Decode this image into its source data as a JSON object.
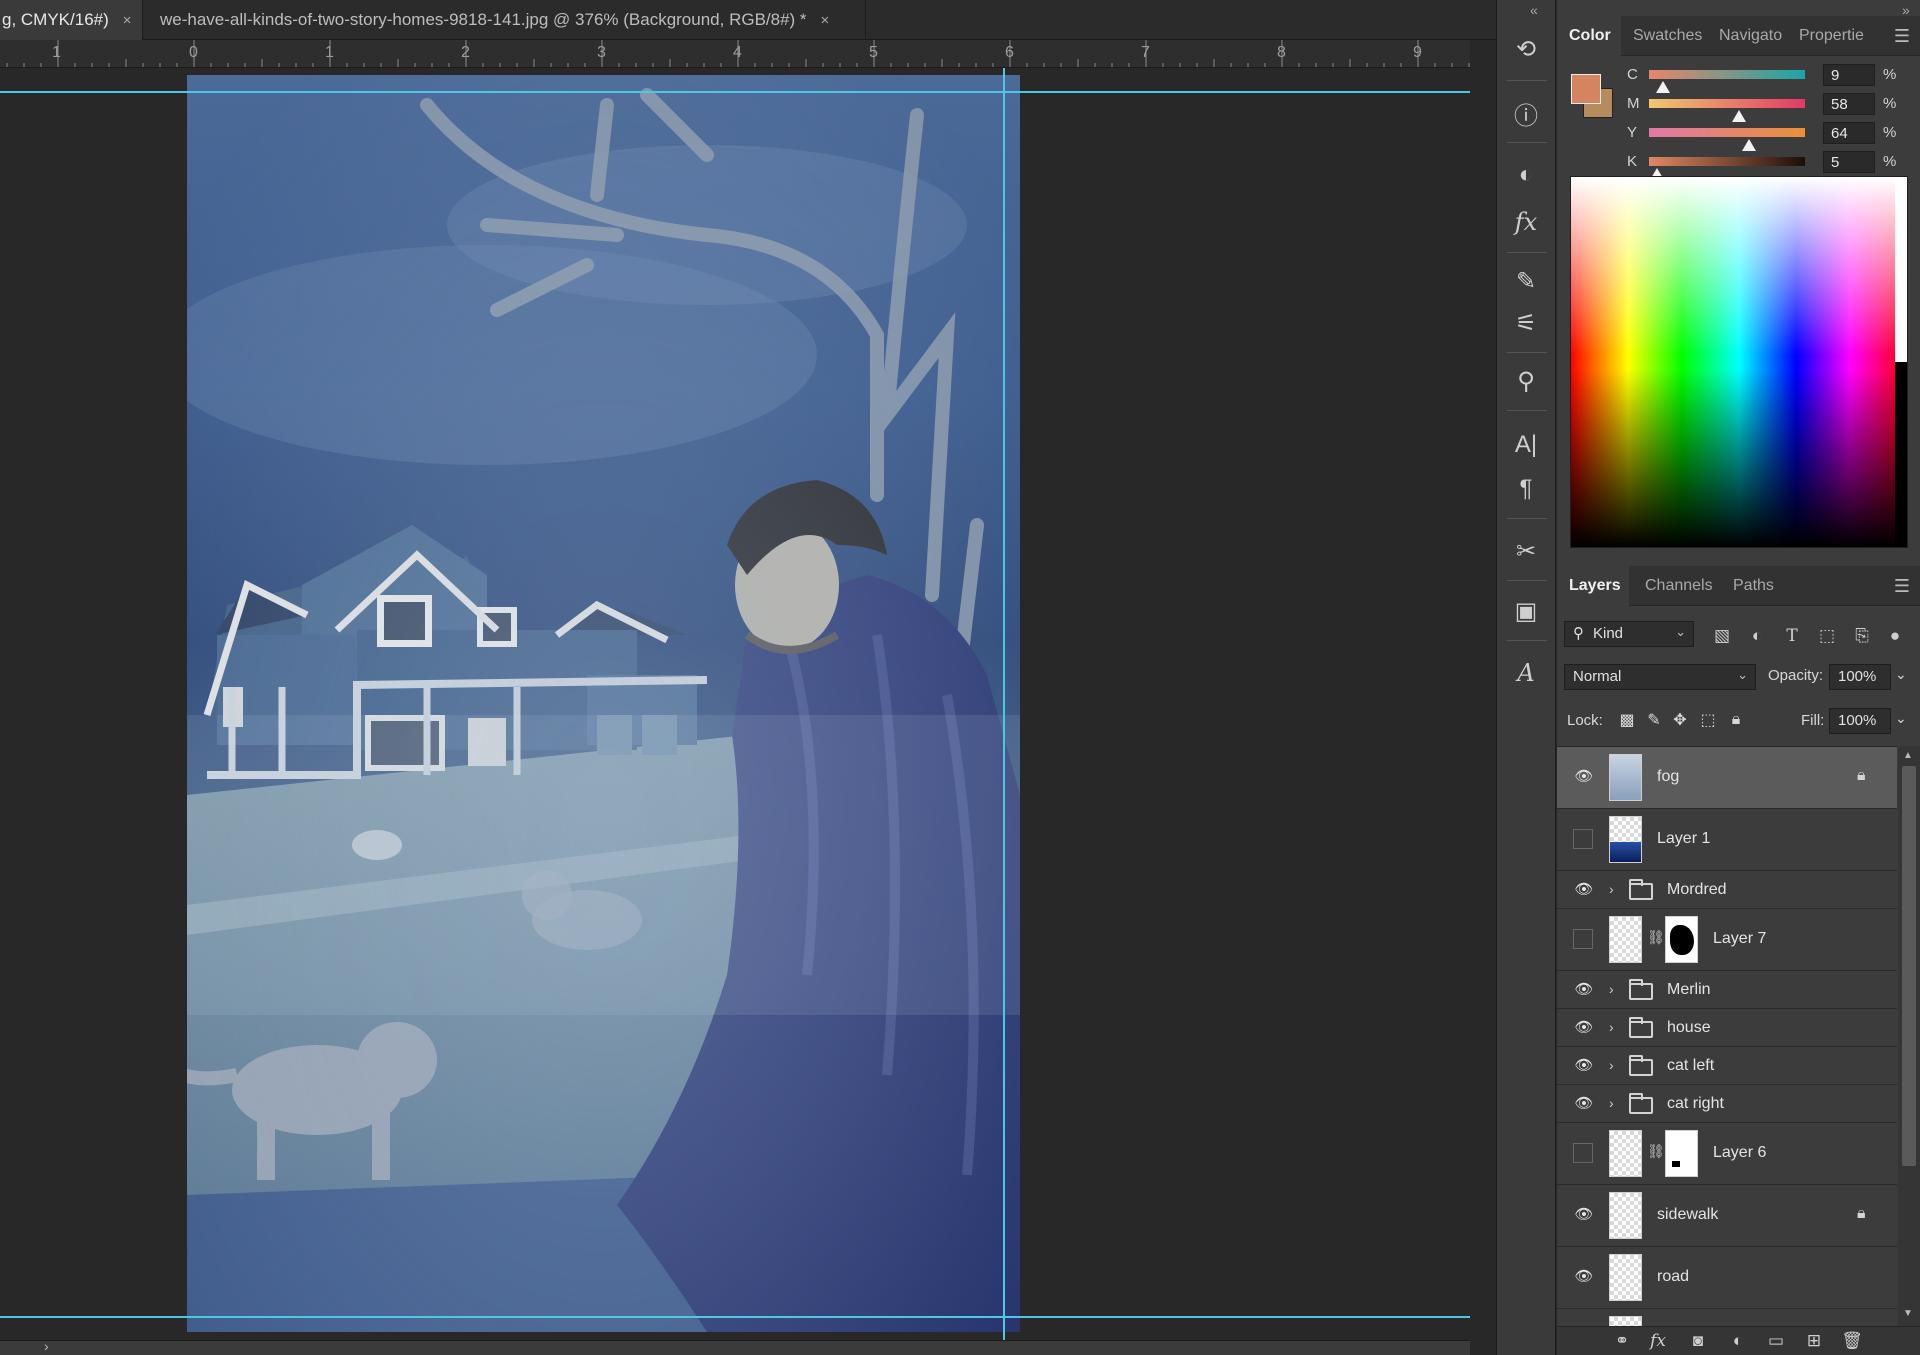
{
  "tabs": [
    {
      "label": "g, CMYK/16#)",
      "close": "×"
    },
    {
      "label": "we-have-all-kinds-of-two-story-homes-9818-141.jpg @ 376% (Background, RGB/8#) *",
      "close": "×"
    }
  ],
  "ruler": {
    "labels": [
      "1",
      "0",
      "1",
      "2",
      "3",
      "4",
      "5",
      "6",
      "7",
      "8",
      "9"
    ]
  },
  "color_panel": {
    "tabs": [
      "Color",
      "Swatches",
      "Navigato",
      "Propertie"
    ],
    "foreground_color": "#d58460",
    "background_color": "#b68c5e",
    "cmyk": [
      {
        "label": "C",
        "value": "9",
        "unit": "%",
        "level": 0.09
      },
      {
        "label": "M",
        "value": "58",
        "unit": "%",
        "level": 0.58
      },
      {
        "label": "Y",
        "value": "64",
        "unit": "%",
        "level": 0.64
      },
      {
        "label": "K",
        "value": "5",
        "unit": "%",
        "level": 0.05
      }
    ]
  },
  "layers_panel": {
    "tabs": [
      "Layers",
      "Channels",
      "Paths"
    ],
    "filter_kind": "Kind",
    "blend_mode": "Normal",
    "opacity_label": "Opacity:",
    "opacity_value": "100%",
    "lock_label": "Lock:",
    "fill_label": "Fill:",
    "fill_value": "100%",
    "layers": [
      {
        "name": "fog",
        "visible": true,
        "kind": "pixel",
        "selected": true,
        "locked": true
      },
      {
        "name": "Layer 1",
        "visible": false,
        "kind": "pixel"
      },
      {
        "name": "Mordred",
        "visible": true,
        "kind": "group"
      },
      {
        "name": "Layer 7",
        "visible": false,
        "kind": "masked"
      },
      {
        "name": "Merlin",
        "visible": true,
        "kind": "group"
      },
      {
        "name": "house",
        "visible": true,
        "kind": "group"
      },
      {
        "name": "cat left",
        "visible": true,
        "kind": "group"
      },
      {
        "name": "cat right",
        "visible": true,
        "kind": "group"
      },
      {
        "name": "Layer 6",
        "visible": false,
        "kind": "masked"
      },
      {
        "name": "sidewalk",
        "visible": true,
        "kind": "pixel",
        "locked": true
      },
      {
        "name": "road",
        "visible": true,
        "kind": "pixel"
      }
    ]
  },
  "icons": {
    "toolbar": [
      "history-icon",
      "info-icon",
      "adjustments-icon",
      "styles-icon",
      "brush-presets-icon",
      "brush-settings-icon",
      "clone-source-icon",
      "character-icon",
      "paragraph-icon",
      "tool-presets-icon",
      "artboard-icon",
      "glyphs-icon"
    ],
    "eye": "eye-icon",
    "lock": "lock-icon"
  }
}
